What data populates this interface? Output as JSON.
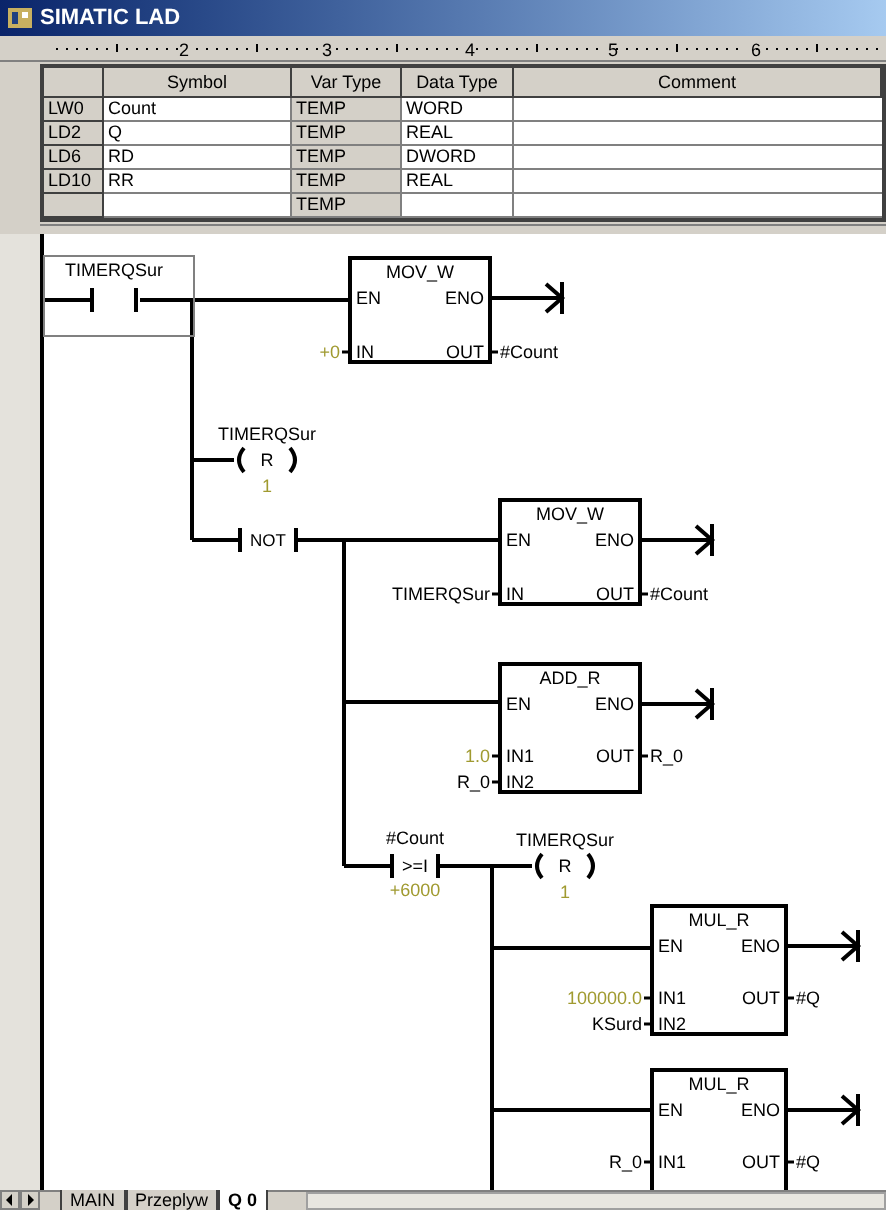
{
  "window": {
    "title": "SIMATIC LAD"
  },
  "ruler": {
    "labels": [
      "2",
      "3",
      "4",
      "5",
      "6"
    ]
  },
  "variable_table": {
    "columns": [
      "Symbol",
      "Var Type",
      "Data Type",
      "Comment"
    ],
    "rows": [
      {
        "address": "LW0",
        "symbol": "Count",
        "var_type": "TEMP",
        "data_type": "WORD"
      },
      {
        "address": "LD2",
        "symbol": "Q",
        "var_type": "TEMP",
        "data_type": "REAL"
      },
      {
        "address": "LD6",
        "symbol": "RD",
        "var_type": "TEMP",
        "data_type": "DWORD"
      },
      {
        "address": "LD10",
        "symbol": "RR",
        "var_type": "TEMP",
        "data_type": "REAL"
      },
      {
        "var_type": "TEMP"
      }
    ]
  },
  "ladder": {
    "elements": [
      {
        "kind": "contact",
        "label": "TIMERQSur",
        "selected": true
      },
      {
        "kind": "box",
        "title": "MOV_W",
        "en": "EN",
        "eno": "ENO",
        "inputs": [
          {
            "pin": "IN",
            "operand": "+0",
            "constant": true
          }
        ],
        "outputs": [
          {
            "pin": "OUT",
            "operand": "#Count"
          }
        ]
      },
      {
        "kind": "coil",
        "label": "TIMERQSur",
        "op": "R",
        "operand": "1"
      },
      {
        "kind": "not",
        "text": "NOT"
      },
      {
        "kind": "box",
        "title": "MOV_W",
        "en": "EN",
        "eno": "ENO",
        "inputs": [
          {
            "pin": "IN",
            "operand": "TIMERQSur",
            "constant": false
          }
        ],
        "outputs": [
          {
            "pin": "OUT",
            "operand": "#Count"
          }
        ]
      },
      {
        "kind": "box",
        "title": "ADD_R",
        "en": "EN",
        "eno": "ENO",
        "inputs": [
          {
            "pin": "IN1",
            "operand": "1.0",
            "constant": true
          },
          {
            "pin": "IN2",
            "operand": "R_0",
            "constant": false
          }
        ],
        "outputs": [
          {
            "pin": "OUT",
            "operand": "R_0"
          }
        ]
      },
      {
        "kind": "compare",
        "label": "#Count",
        "op": ">=I",
        "operand": "+6000"
      },
      {
        "kind": "coil",
        "label": "TIMERQSur",
        "op": "R",
        "operand": "1"
      },
      {
        "kind": "box",
        "title": "MUL_R",
        "en": "EN",
        "eno": "ENO",
        "inputs": [
          {
            "pin": "IN1",
            "operand": "100000.0",
            "constant": true
          },
          {
            "pin": "IN2",
            "operand": "KSurd",
            "constant": false
          }
        ],
        "outputs": [
          {
            "pin": "OUT",
            "operand": "#Q"
          }
        ]
      },
      {
        "kind": "box",
        "title": "MUL_R",
        "en": "EN",
        "eno": "ENO",
        "inputs": [
          {
            "pin": "IN1",
            "operand": "R_0",
            "constant": false
          }
        ],
        "outputs": [
          {
            "pin": "OUT",
            "operand": "#Q"
          }
        ]
      }
    ]
  },
  "sheet_tabs": [
    {
      "label": "MAIN",
      "selected": false
    },
    {
      "label": "Przeplyw",
      "selected": false
    },
    {
      "label": "Q 0",
      "selected": true
    }
  ]
}
